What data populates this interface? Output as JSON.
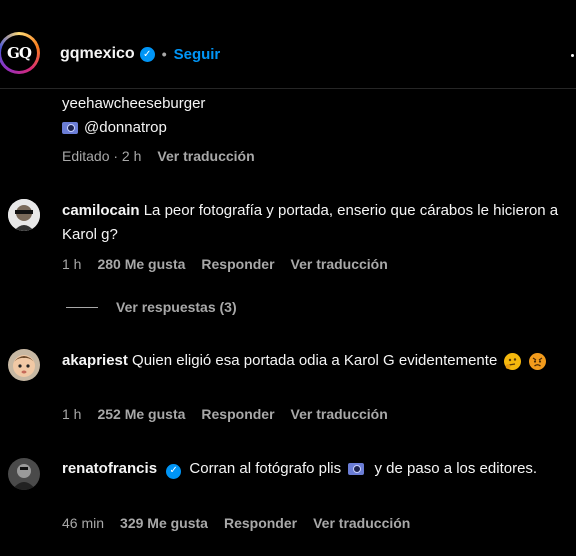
{
  "header": {
    "logo_text": "GQ",
    "username": "gqmexico",
    "separator": "•",
    "follow_label": "Seguir"
  },
  "first_comment": {
    "line1": "yeehawcheeseburger",
    "mention": "@donnatrop",
    "meta_edited": "Editado · 2 h",
    "meta_translate": "Ver traducción"
  },
  "comments": [
    {
      "username": "camilocain",
      "text": "La peor fotografía y portada, enserio que cárabos le hicieron a Karol g?",
      "time": "1 h",
      "likes": "280 Me gusta",
      "reply": "Responder",
      "translate": "Ver traducción"
    },
    {
      "username": "akapriest",
      "text": "Quien eligió esa portada odia a Karol G evidentemente",
      "time": "1 h",
      "likes": "252 Me gusta",
      "reply": "Responder",
      "translate": "Ver traducción"
    },
    {
      "username": "renatofrancis",
      "text_before": "Corran al fotógrafo plis",
      "text_after": "y de paso a los editores.",
      "time": "46 min",
      "likes": "329 Me gusta",
      "reply": "Responder",
      "translate": "Ver traducción"
    }
  ],
  "replies_toggle": "Ver respuestas (3)",
  "icons": {
    "verified": "verified-badge-icon",
    "camera_emoji": "camera-emoji-icon",
    "thinking_emoji": "thinking-face-emoji",
    "angry_emoji": "angry-face-emoji"
  },
  "colors": {
    "accent": "#0095f6",
    "muted": "#a8a8a8",
    "background": "#000000"
  }
}
